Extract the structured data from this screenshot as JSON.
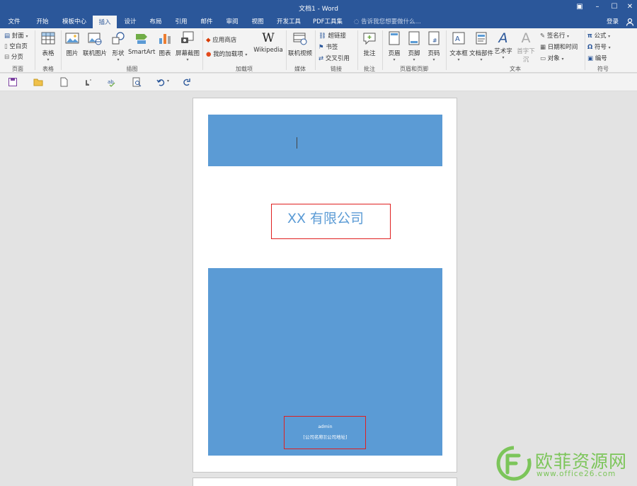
{
  "window": {
    "title": "文档1 - Word"
  },
  "tabs": [
    {
      "label": "文件"
    },
    {
      "label": "开始"
    },
    {
      "label": "模板中心"
    },
    {
      "label": "插入"
    },
    {
      "label": "设计"
    },
    {
      "label": "布局"
    },
    {
      "label": "引用"
    },
    {
      "label": "邮件"
    },
    {
      "label": "审阅"
    },
    {
      "label": "视图"
    },
    {
      "label": "开发工具"
    },
    {
      "label": "PDF工具集"
    }
  ],
  "active_tab": "插入",
  "tell_me": "告诉我您想要做什么...",
  "login": "登录",
  "ribbon": {
    "pages": {
      "cover": "封面",
      "blank": "空白页",
      "break": "分页",
      "label": "页面"
    },
    "tables": {
      "table": "表格",
      "label": "表格"
    },
    "illustrations": {
      "picture": "图片",
      "online_picture": "联机图片",
      "shapes": "形状",
      "smartart": "SmartArt",
      "chart": "图表",
      "screenshot": "屏幕截图",
      "label": "插图"
    },
    "addins": {
      "store": "应用商店",
      "my_addins": "我的加载项",
      "wikipedia": "Wikipedia",
      "label": "加载项"
    },
    "media": {
      "online_video": "联机视频",
      "label": "媒体"
    },
    "links": {
      "hyperlink": "超链接",
      "bookmark": "书签",
      "crossref": "交叉引用",
      "label": "链接"
    },
    "comments": {
      "comment": "批注",
      "label": "批注"
    },
    "header_footer": {
      "header": "页眉",
      "footer": "页脚",
      "page_number": "页码",
      "label": "页眉和页脚"
    },
    "text": {
      "textbox": "文本框",
      "quickparts": "文档部件",
      "wordart": "艺术字",
      "dropcap": "首字下沉",
      "signature": "签名行",
      "datetime": "日期和时间",
      "object": "对象",
      "label": "文本"
    },
    "symbols": {
      "equation": "公式",
      "symbol": "符号",
      "numbering": "编号",
      "label": "符号"
    }
  },
  "document": {
    "company": "XX 有限公司",
    "author": "admin",
    "address": "[公司名称][公司地址]"
  },
  "watermark": {
    "title": "欧菲资源网",
    "url": "www.office26.com"
  },
  "colors": {
    "titlebar": "#2b579a",
    "accent_blue": "#5b9bd5",
    "highlight_red": "#e02020",
    "watermark_green": "#7cc55a"
  }
}
